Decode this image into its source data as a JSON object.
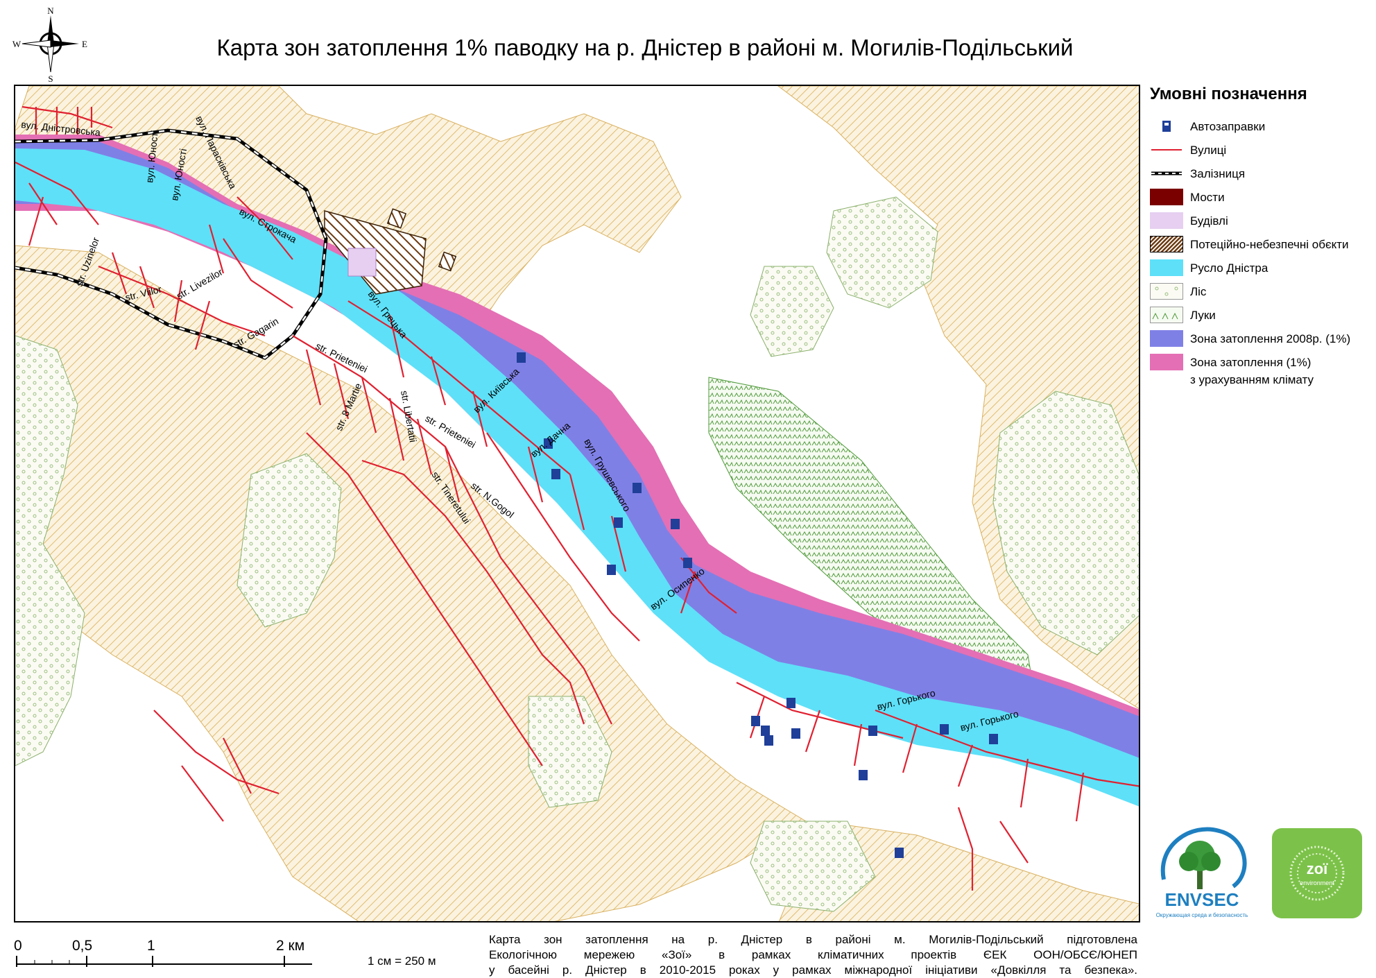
{
  "title": "Карта зон затоплення 1% паводку на р. Дністер в районі м. Могилів-Подільський",
  "compass": {
    "n": "N",
    "s": "S",
    "e": "E",
    "w": "W"
  },
  "legend": {
    "title": "Умовні позначення",
    "items": [
      {
        "label": "Автозаправки",
        "symbol": "gas-station",
        "color": "#1f3f99"
      },
      {
        "label": "Вулиці",
        "symbol": "line",
        "color": "#e02030"
      },
      {
        "label": "Залізниця",
        "symbol": "railway",
        "color": "#000000"
      },
      {
        "label": "Мости",
        "symbol": "fill",
        "color": "#7a0000"
      },
      {
        "label": "Будівлі",
        "symbol": "fill",
        "color": "#e6cff0"
      },
      {
        "label": "Потеційно-небезпечні обєкти",
        "symbol": "hatch",
        "color": "#6b3a10"
      },
      {
        "label": "Русло Дністра",
        "symbol": "fill",
        "color": "#5ee0f8"
      },
      {
        "label": "Ліс",
        "symbol": "forest",
        "color": "#9bbf7f"
      },
      {
        "label": "Луки",
        "symbol": "meadow",
        "color": "#4f9a3a"
      },
      {
        "label": "Зона затоплення 2008р. (1%)",
        "symbol": "fill",
        "color": "#7f80e6"
      },
      {
        "label": "Зона затоплення (1%)",
        "label2": "з урахуванням клімату",
        "symbol": "fill",
        "color": "#e46fb4"
      }
    ]
  },
  "streets": {
    "dnistrovska": "вул. Дністровська",
    "yunosti1": "вул. Юності",
    "yunosti2": "вул. Юності",
    "paraskivska": "вул. Парасківська",
    "strokacha": "вул. Строкача",
    "gretska": "вул. Грецька",
    "kyivska": "вул. Київська",
    "dachna": "вул. Дачна",
    "grushevskogo": "вул. Грушевського",
    "osypenko": "вул. Осипенко",
    "gorkogo1": "вул. Горького",
    "gorkogo2": "вул. Горького",
    "uzinelor": "str. Uzinelor",
    "livezilor": "str. Livezilor",
    "viilor": "str. Viilor",
    "gagarin": "str. Gagarin",
    "prieteniei1": "str. Prieteniei",
    "prieteniei2": "str. Prieteniei",
    "martie": "str. 8 Martie",
    "libertatii": "str. Libertatii",
    "ngogol": "str. N.Gogol",
    "tineretului": "str. Tineretului"
  },
  "scale": {
    "ticks": [
      "0",
      "0,5",
      "1",
      "2 км"
    ],
    "ratio": "1 см = 250 м"
  },
  "credits": [
    "Карта зон затоплення на р. Дністер в районі м. Могилів-Подільський підготовлена",
    "Екологічною мережею «Зої» в рамках кліматичних проектів ЄЕК ООН/ОБСЄ/ЮНЕП",
    "у басейні р. Дністер в 2010-2015 роках у рамках міжнародної ініціативи «Довкілля та безпека»."
  ],
  "logos": {
    "envsec": "ENVSEC",
    "envsec_sub": "Окружающая среда и безопасность",
    "zoi": "zoï",
    "zoi_sub": "environment"
  },
  "colors": {
    "river": "#5ee0f8",
    "flood2008": "#7f80e6",
    "floodClimate": "#e46fb4",
    "street": "#e02030",
    "orchard": "#e8c98a",
    "forest": "#9bbf7f",
    "meadow": "#4f9a3a"
  }
}
